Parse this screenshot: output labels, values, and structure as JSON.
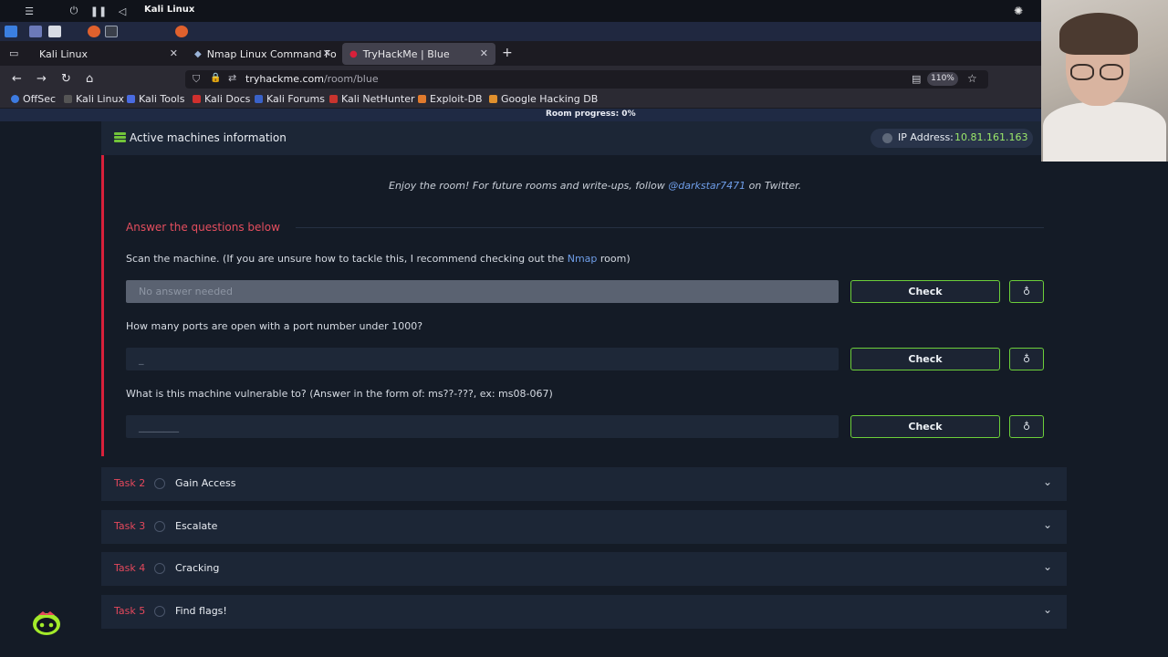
{
  "window_title": "Kali Linux",
  "browser": {
    "tabs": [
      {
        "label": "Kali Linux"
      },
      {
        "label": "Nmap Linux Command Fo"
      },
      {
        "label": "TryHackMe | Blue"
      }
    ],
    "url_host": "tryhackme.com",
    "url_path": "/room/blue",
    "zoom": "110%",
    "bookmarks": [
      "OffSec",
      "Kali Linux",
      "Kali Tools",
      "Kali Docs",
      "Kali Forums",
      "Kali NetHunter",
      "Exploit-DB",
      "Google Hacking DB"
    ]
  },
  "room": {
    "progress_text": "Room progress: 0%",
    "machine_label": "Active machines information",
    "ip_label": "IP Address:",
    "ip_value": "10.81.161.163",
    "enjoy_text": "Enjoy the room! For future rooms and write-ups, follow ",
    "enjoy_link": "@darkstar7471",
    "enjoy_suffix": " on Twitter.",
    "answer_heading": "Answer the questions below",
    "questions": [
      {
        "text_a": "Scan the machine. (If you are unsure how to tackle this, I recommend checking out the ",
        "link": "Nmap",
        "text_b": " room)",
        "placeholder": "No answer needed",
        "check": "Check"
      },
      {
        "text_a": "How many ports are open with a port number under 1000?",
        "link": "",
        "text_b": "",
        "placeholder": "_",
        "check": "Check"
      },
      {
        "text_a": "What is this machine vulnerable to? (Answer in the form of: ms??-???, ex: ms08-067)",
        "link": "",
        "text_b": "",
        "placeholder": "________",
        "check": "Check"
      }
    ],
    "tasks": [
      {
        "num": "Task 2",
        "name": "Gain Access"
      },
      {
        "num": "Task 3",
        "name": "Escalate"
      },
      {
        "num": "Task 4",
        "name": "Cracking"
      },
      {
        "num": "Task 5",
        "name": "Find flags!"
      }
    ]
  },
  "colors": {
    "accent_green": "#6ccf3a",
    "accent_red": "#d8203a",
    "ip_green": "#9be86a"
  }
}
